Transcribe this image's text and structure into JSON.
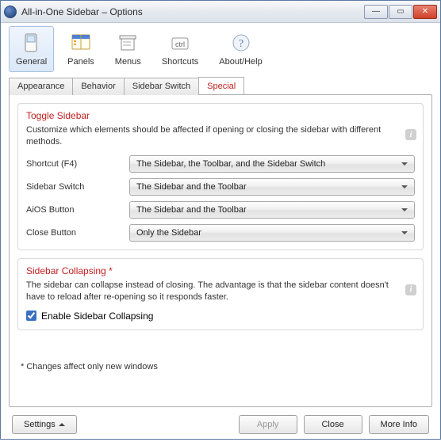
{
  "window": {
    "title": "All-in-One Sidebar – Options"
  },
  "toolbar": {
    "items": [
      {
        "label": "General"
      },
      {
        "label": "Panels"
      },
      {
        "label": "Menus"
      },
      {
        "label": "Shortcuts"
      },
      {
        "label": "About/Help"
      }
    ]
  },
  "tabs": {
    "items": [
      {
        "label": "Appearance"
      },
      {
        "label": "Behavior"
      },
      {
        "label": "Sidebar Switch"
      },
      {
        "label": "Special"
      }
    ]
  },
  "toggle": {
    "title": "Toggle Sidebar",
    "desc": "Customize which elements should be affected if opening or closing the sidebar with different methods.",
    "rows": {
      "shortcut": {
        "label": "Shortcut (F4)",
        "value": "The Sidebar, the Toolbar, and the Sidebar Switch"
      },
      "switch": {
        "label": "Sidebar Switch",
        "value": "The Sidebar and the Toolbar"
      },
      "aios": {
        "label": "AiOS Button",
        "value": "The Sidebar and the Toolbar"
      },
      "close": {
        "label": "Close Button",
        "value": "Only the Sidebar"
      }
    }
  },
  "collapse": {
    "title": "Sidebar Collapsing *",
    "desc": "The sidebar can collapse instead of closing. The advantage is that the sidebar content doesn't have to reload after re-opening so it responds faster.",
    "checkbox_label": "Enable Sidebar Collapsing",
    "checked": true
  },
  "footnote": "* Changes affect only new windows",
  "buttons": {
    "settings": "Settings",
    "apply": "Apply",
    "close": "Close",
    "more": "More Info"
  }
}
